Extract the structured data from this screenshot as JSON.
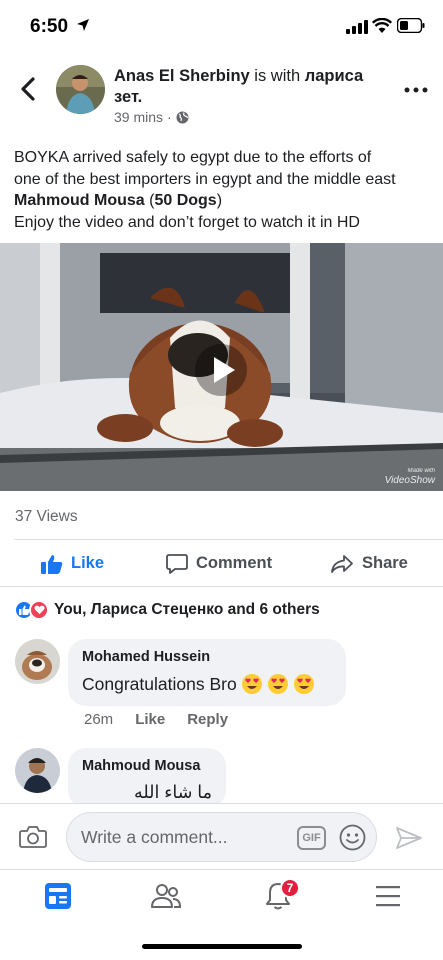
{
  "status_bar": {
    "time": "6:50"
  },
  "post": {
    "author": "Anas El Sherbiny",
    "with_text": " is with ",
    "tagged": "лариса зет.",
    "time_ago": "39 mins",
    "separator": "·",
    "text_line1": "BOYKA arrived safely to egypt due to the efforts of",
    "text_line2": "one of the best importers in egypt and the middle east",
    "mention": "Mahmoud Mousa",
    "mention_paren_open": " (",
    "mention_suffix": "50 Dogs",
    "mention_paren_close": ")",
    "text_line4": "Enjoy the video and don’t forget to watch it in HD",
    "watermark_small": "Made with",
    "watermark": "VideoShow",
    "views": "37 Views"
  },
  "actions": {
    "like": "Like",
    "comment": "Comment",
    "share": "Share"
  },
  "reactions": {
    "summary": "You, Лариса Стеценко and 6 others"
  },
  "comments": [
    {
      "name": "Mohamed Hussein",
      "text": "Congratulations Bro",
      "time": "26m",
      "like": "Like",
      "reply": "Reply"
    },
    {
      "name": "Mahmoud Mousa",
      "text": "ما شاء الله"
    }
  ],
  "composer": {
    "placeholder": "Write a comment...",
    "gif": "GIF"
  },
  "tabs": {
    "notifications_badge": "7"
  },
  "colors": {
    "brand": "#1877f2",
    "badge": "#e41e3f",
    "love": "#f33e58"
  }
}
